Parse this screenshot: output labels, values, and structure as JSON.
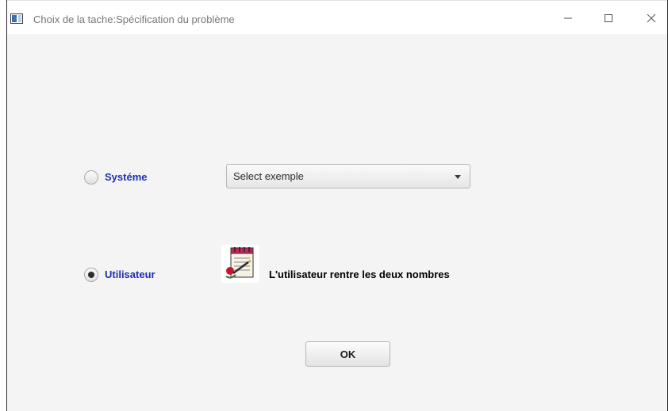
{
  "window": {
    "title": "Choix de la tache:Spécification du problème"
  },
  "options": {
    "systeme": {
      "label": "Systéme",
      "selected": false
    },
    "utilisateur": {
      "label": "Utilisateur",
      "selected": true
    }
  },
  "select": {
    "value": "Select exemple"
  },
  "user_note": {
    "icon": "notepad-pen-icon",
    "text": "L'utilisateur rentre les deux nombres"
  },
  "ok_button": {
    "label": "OK"
  },
  "colors": {
    "option_label": "#1e2fb4",
    "background": "#f4f4f4"
  }
}
